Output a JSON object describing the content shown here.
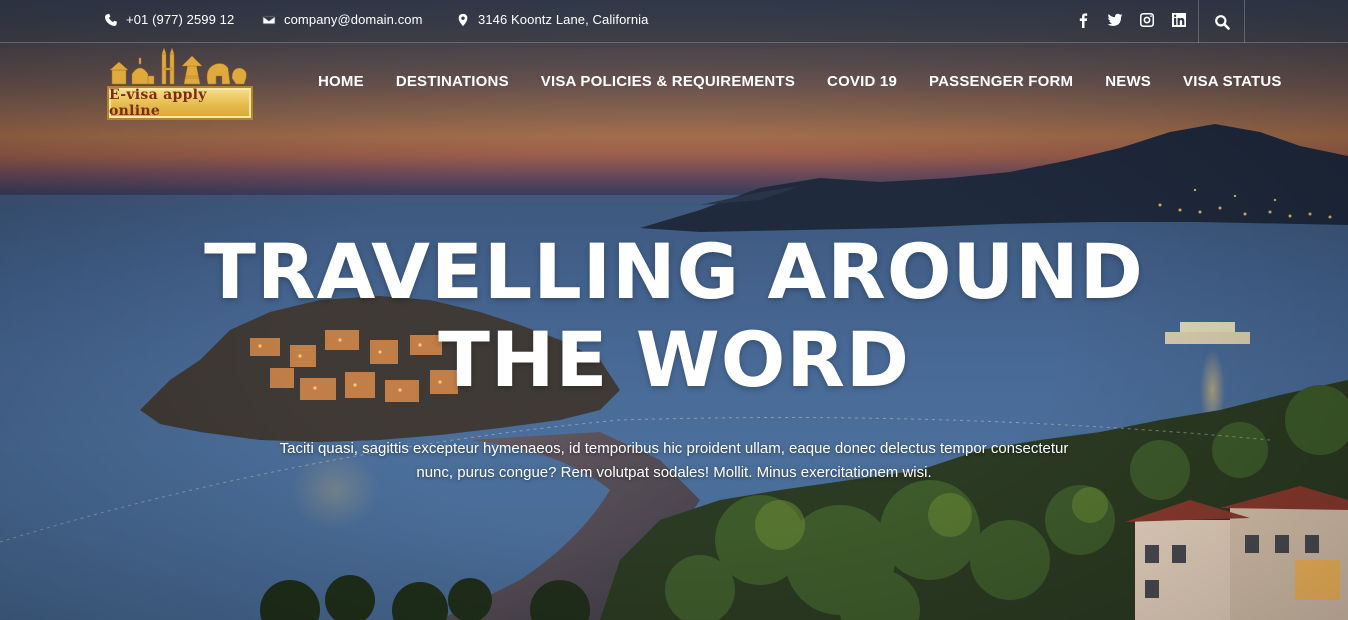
{
  "topbar": {
    "phone": "+01 (977) 2599 12",
    "email": "company@domain.com",
    "address": "3146 Koontz Lane, California",
    "socials": [
      "facebook-icon",
      "twitter-icon",
      "instagram-icon",
      "linkedin-icon"
    ],
    "search_icon": "search-icon"
  },
  "logo": {
    "text": "E-visa apply online",
    "icon": "landmarks-logo-icon"
  },
  "nav": {
    "items": [
      {
        "label": "HOME"
      },
      {
        "label": "DESTINATIONS"
      },
      {
        "label": "VISA POLICIES & REQUIREMENTS"
      },
      {
        "label": "COVID 19"
      },
      {
        "label": "PASSENGER FORM"
      },
      {
        "label": "NEWS"
      },
      {
        "label": "VISA STATUS"
      }
    ]
  },
  "hero": {
    "headline_line1": "TRAVELLING AROUND",
    "headline_line2": "THE WORD",
    "subtext_line1": "Taciti quasi, sagittis excepteur hymenaeos, id temporibus hic proident ullam, eaque donec delectus tempor consectetur",
    "subtext_line2": "nunc, purus congue? Rem volutpat sodales! Mollit. Minus exercitationem wisi."
  },
  "colors": {
    "accent_gold": "#e8bf52",
    "logo_text": "#7a2d12",
    "text": "#ffffff"
  }
}
